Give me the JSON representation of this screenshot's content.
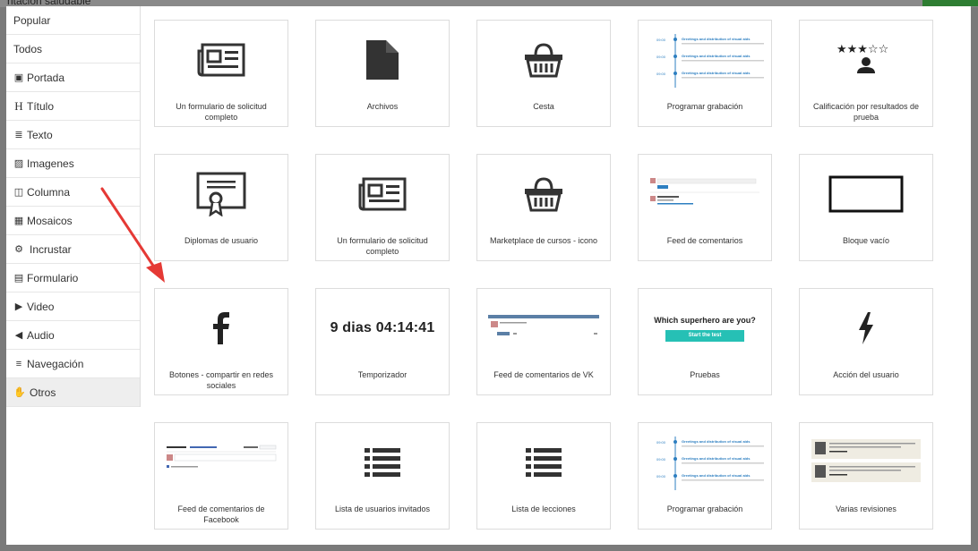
{
  "background": {
    "title": "ntación saludable"
  },
  "sidebar": {
    "items": [
      {
        "label": "Popular",
        "icon": ""
      },
      {
        "label": "Todos",
        "icon": ""
      },
      {
        "label": "Portada",
        "icon": "image-icon"
      },
      {
        "label": "Título",
        "icon": "heading-icon"
      },
      {
        "label": "Texto",
        "icon": "text-lines-icon"
      },
      {
        "label": "Imagenes",
        "icon": "picture-icon"
      },
      {
        "label": "Columna",
        "icon": "columns-icon"
      },
      {
        "label": "Mosaicos",
        "icon": "grid-icon"
      },
      {
        "label": "Incrustar",
        "icon": "embed-icon"
      },
      {
        "label": "Formulario",
        "icon": "form-icon"
      },
      {
        "label": "Video",
        "icon": "youtube-icon"
      },
      {
        "label": "Audio",
        "icon": "speaker-icon"
      },
      {
        "label": "Navegación",
        "icon": "hamburger-icon"
      },
      {
        "label": "Otros",
        "icon": "hand-icon"
      }
    ],
    "active": "Otros"
  },
  "cards": [
    {
      "label": "Un formulario de solicitud completo",
      "icon": "newspaper-icon"
    },
    {
      "label": "Archivos",
      "icon": "file-icon"
    },
    {
      "label": "Cesta",
      "icon": "basket-icon"
    },
    {
      "label": "Programar grabación",
      "icon": "timeline-preview"
    },
    {
      "label": "Calificación por resultados de prueba",
      "icon": "stars-user-icon"
    },
    {
      "label": "Diplomas de usuario",
      "icon": "diploma-icon"
    },
    {
      "label": "Un formulario de solicitud completo",
      "icon": "newspaper-icon"
    },
    {
      "label": "Marketplace de cursos - icono",
      "icon": "basket-icon"
    },
    {
      "label": "Feed de comentarios",
      "icon": "comments-preview"
    },
    {
      "label": "Bloque vacío",
      "icon": "empty-block-icon"
    },
    {
      "label": "Botones - compartir en redes sociales",
      "icon": "facebook-icon"
    },
    {
      "label": "Temporizador",
      "icon": "timer-text",
      "timer": "9 dias 04:14:41"
    },
    {
      "label": "Feed de comentarios de VK",
      "icon": "vk-comments-preview"
    },
    {
      "label": "Pruebas",
      "icon": "quiz-preview",
      "question": "Which superhero are you?",
      "button": "Start the test"
    },
    {
      "label": "Acción del usuario",
      "icon": "lightning-icon"
    },
    {
      "label": "Feed de comentarios de Facebook",
      "icon": "fb-comments-preview"
    },
    {
      "label": "Lista de usuarios invitados",
      "icon": "list-icon"
    },
    {
      "label": "Lista de lecciones",
      "icon": "list-icon"
    },
    {
      "label": "Programar grabación",
      "icon": "timeline-preview"
    },
    {
      "label": "Varias revisiones",
      "icon": "reviews-preview"
    }
  ],
  "timeline": {
    "times": [
      "09:00",
      "09:00",
      "09:00"
    ],
    "title": "Greetings and distribution of visual aids"
  },
  "colors": {
    "accent": "#2d7fc1",
    "arrow": "#e53935",
    "quiz": "#26c0b5"
  }
}
